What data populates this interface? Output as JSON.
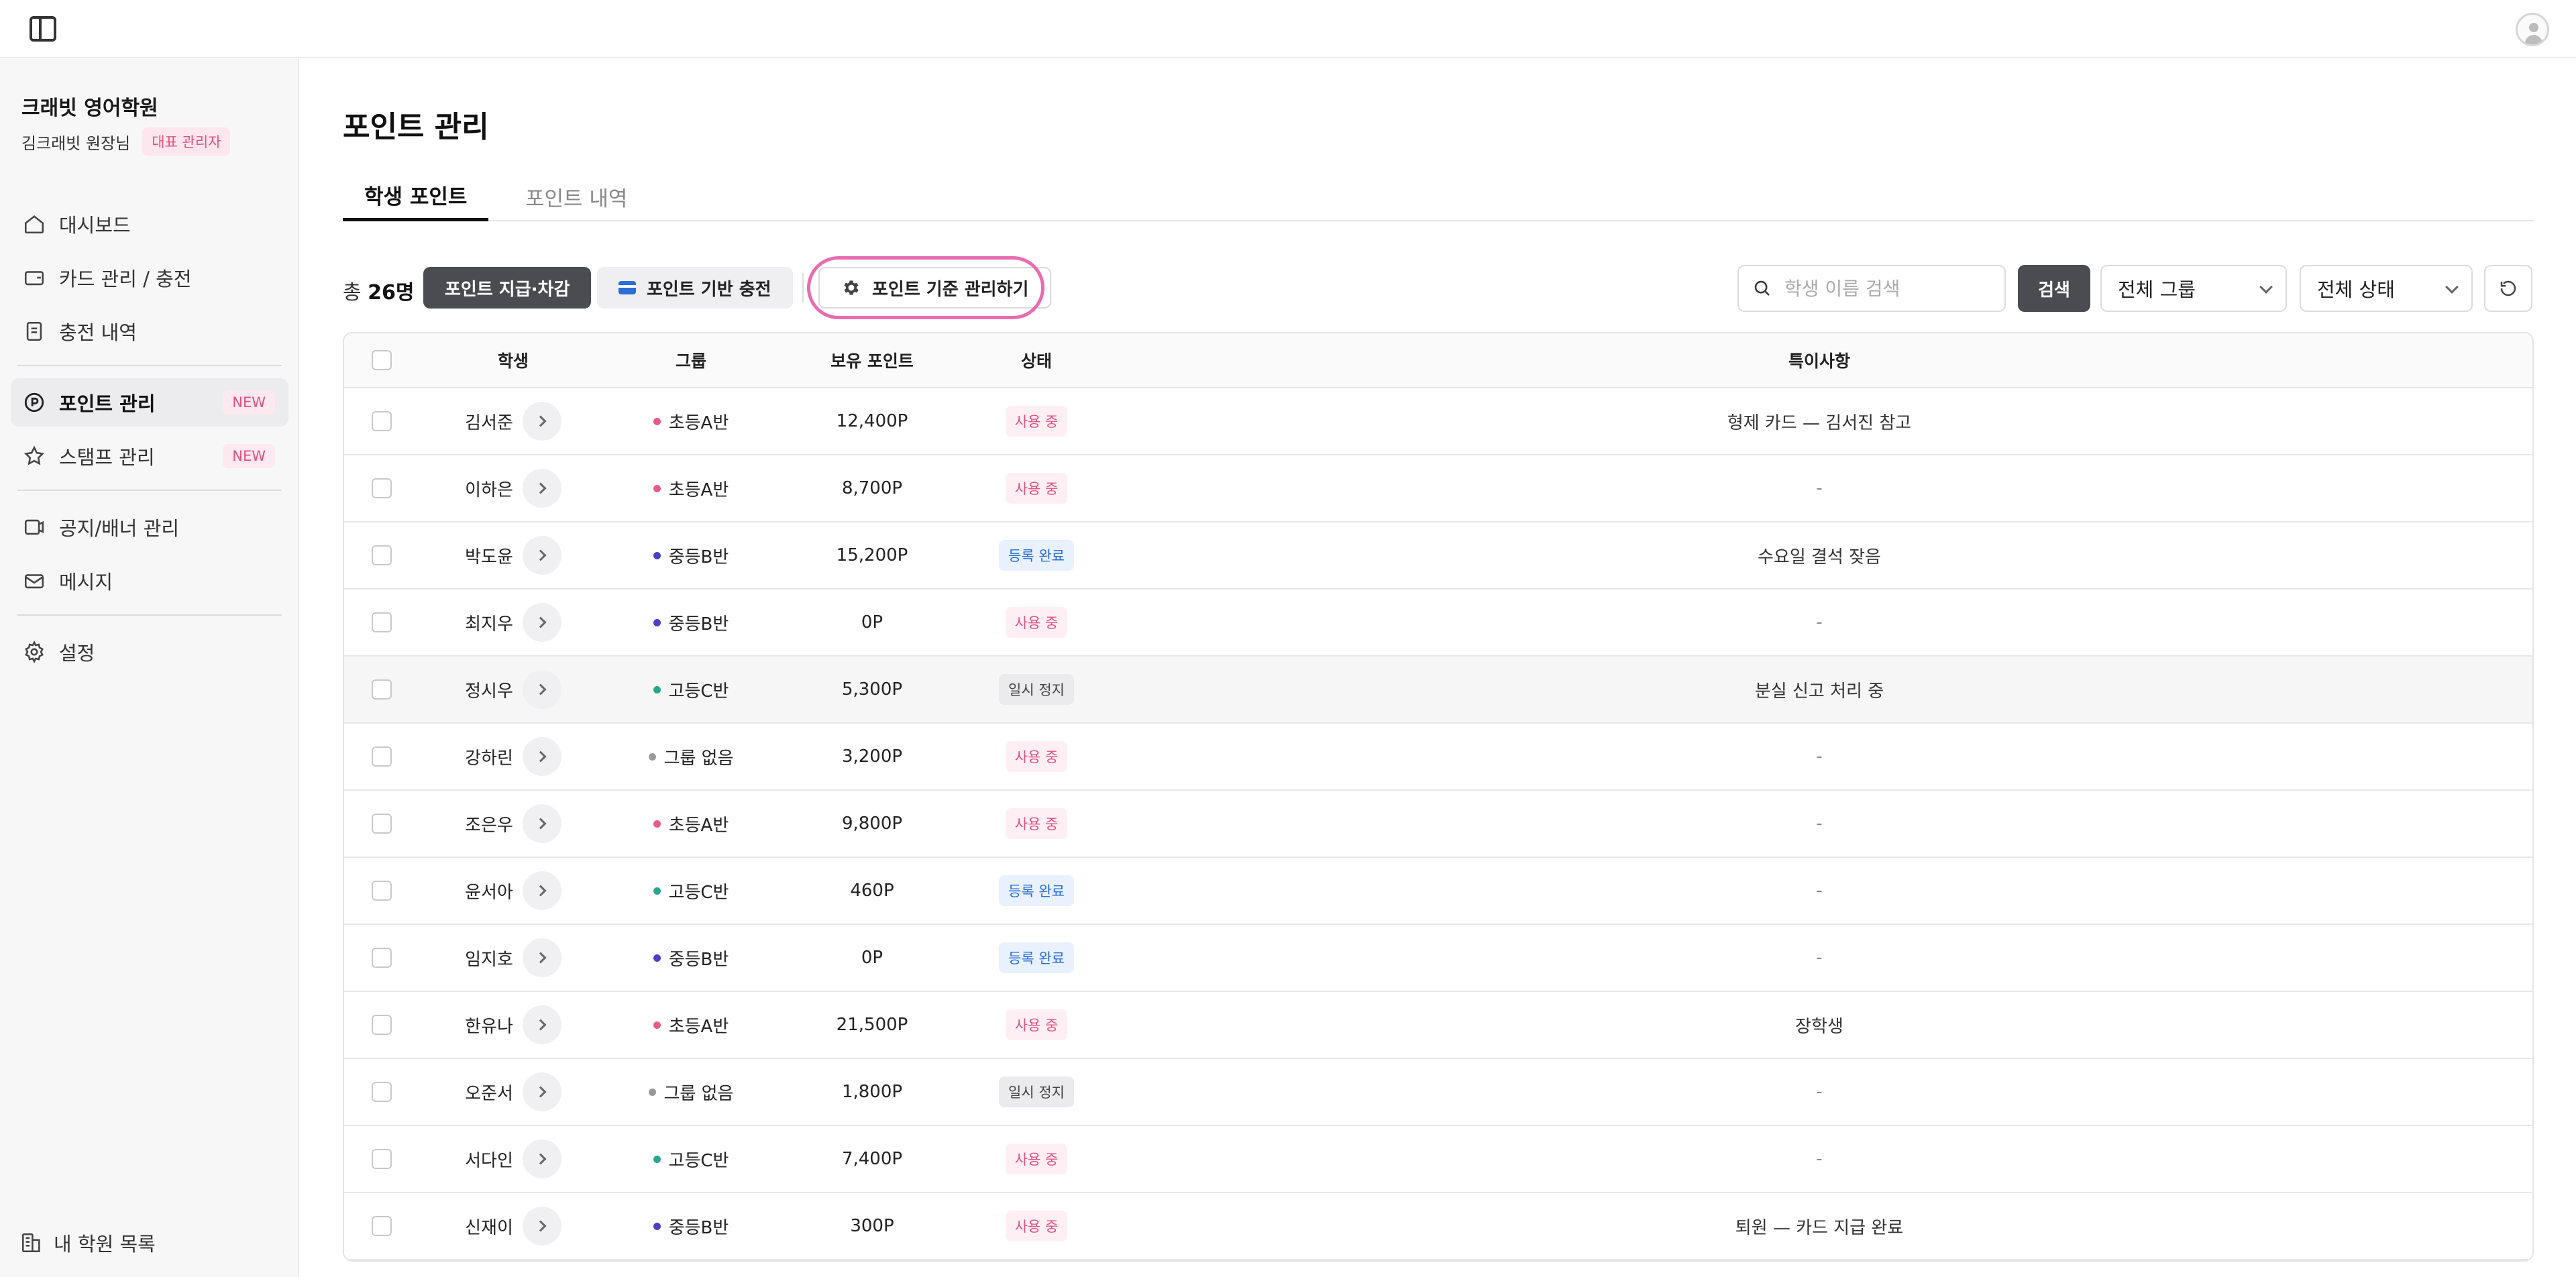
{
  "header": {
    "sidebar_toggle_icon": "sidebar-toggle-icon",
    "avatar_icon": "user-avatar-icon"
  },
  "sidebar": {
    "org_name": "크래빗 영어학원",
    "user_name": "김크래빗 원장님",
    "user_role_badge": "대표 관리자",
    "groups": [
      [
        {
          "label": "대시보드",
          "icon": "home-icon"
        },
        {
          "label": "카드 관리 / 충전",
          "icon": "wallet-icon"
        },
        {
          "label": "충전 내역",
          "icon": "document-icon"
        }
      ],
      [
        {
          "label": "포인트 관리",
          "icon": "point-icon",
          "badge": "NEW",
          "active": true
        },
        {
          "label": "스탬프 관리",
          "icon": "star-icon",
          "badge": "NEW"
        }
      ],
      [
        {
          "label": "공지/배너 관리",
          "icon": "banner-icon"
        },
        {
          "label": "메시지",
          "icon": "mail-icon"
        }
      ],
      [
        {
          "label": "설정",
          "icon": "gear-icon"
        }
      ]
    ],
    "footer_label": "내 학원 목록"
  },
  "main": {
    "title": "포인트 관리",
    "tabs": [
      {
        "label": "학생 포인트",
        "active": true
      },
      {
        "label": "포인트 내역"
      }
    ],
    "toolbar": {
      "total_prefix": "총",
      "total_count": "26명",
      "give_button": "포인트 지급·차감",
      "charge_button": "포인트 기반 충전",
      "rules_button": "포인트 기준 관리하기",
      "search_placeholder": "학생 이름 검색",
      "search_button": "검색",
      "group_select": "전체 그룹",
      "status_select": "전체 상태"
    },
    "table": {
      "columns": [
        "학생",
        "그룹",
        "보유 포인트",
        "상태",
        "특이사항"
      ],
      "rows": [
        {
          "name": "김서준",
          "group": "초등A반",
          "group_color": "#e75a8c",
          "points": "12,400P",
          "status": "사용 중",
          "status_type": "use",
          "note": "형제 카드 — 김서진 참고"
        },
        {
          "name": "이하은",
          "group": "초등A반",
          "group_color": "#e75a8c",
          "points": "8,700P",
          "status": "사용 중",
          "status_type": "use",
          "note": "-"
        },
        {
          "name": "박도윤",
          "group": "중등B반",
          "group_color": "#4b3fc4",
          "points": "15,200P",
          "status": "등록 완료",
          "status_type": "reg",
          "note": "수요일 결석 잦음"
        },
        {
          "name": "최지우",
          "group": "중등B반",
          "group_color": "#4b3fc4",
          "points": "0P",
          "status": "사용 중",
          "status_type": "use",
          "note": "-"
        },
        {
          "name": "정시우",
          "group": "고등C반",
          "group_color": "#2aa58f",
          "points": "5,300P",
          "status": "일시 정지",
          "status_type": "pause",
          "note": "분실 신고 처리 중",
          "hover": true
        },
        {
          "name": "강하린",
          "group": "그룹 없음",
          "group_color": "#999999",
          "points": "3,200P",
          "status": "사용 중",
          "status_type": "use",
          "note": "-"
        },
        {
          "name": "조은우",
          "group": "초등A반",
          "group_color": "#e75a8c",
          "points": "9,800P",
          "status": "사용 중",
          "status_type": "use",
          "note": "-"
        },
        {
          "name": "윤서아",
          "group": "고등C반",
          "group_color": "#2aa58f",
          "points": "460P",
          "status": "등록 완료",
          "status_type": "reg",
          "note": "-"
        },
        {
          "name": "임지호",
          "group": "중등B반",
          "group_color": "#4b3fc4",
          "points": "0P",
          "status": "등록 완료",
          "status_type": "reg",
          "note": "-"
        },
        {
          "name": "한유나",
          "group": "초등A반",
          "group_color": "#e75a8c",
          "points": "21,500P",
          "status": "사용 중",
          "status_type": "use",
          "note": "장학생"
        },
        {
          "name": "오준서",
          "group": "그룹 없음",
          "group_color": "#999999",
          "points": "1,800P",
          "status": "일시 정지",
          "status_type": "pause",
          "note": "-"
        },
        {
          "name": "서다인",
          "group": "고등C반",
          "group_color": "#2aa58f",
          "points": "7,400P",
          "status": "사용 중",
          "status_type": "use",
          "note": "-"
        },
        {
          "name": "신재이",
          "group": "중등B반",
          "group_color": "#4b3fc4",
          "points": "300P",
          "status": "사용 중",
          "status_type": "use",
          "note": "퇴원 — 카드 지급 완료"
        }
      ]
    }
  }
}
